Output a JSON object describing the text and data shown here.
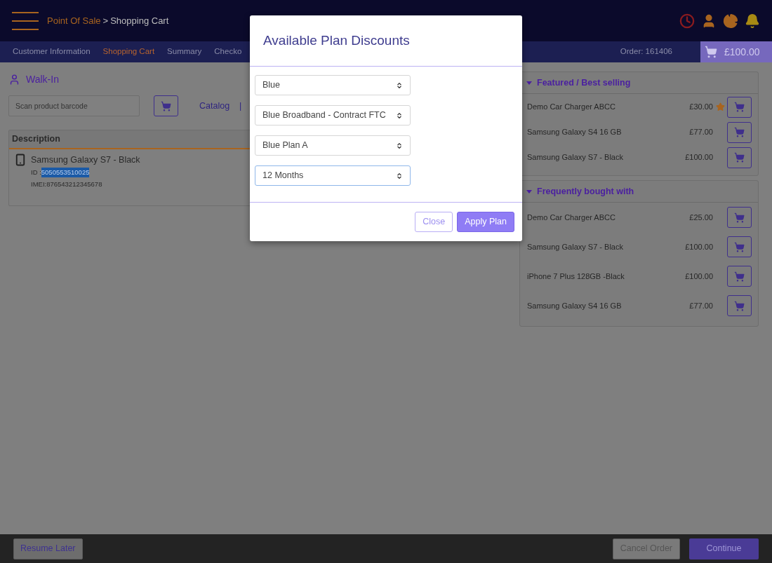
{
  "header": {
    "breadcrumb_root": "Point Of Sale",
    "breadcrumb_separator": ">",
    "breadcrumb_current": "Shopping Cart"
  },
  "nav": {
    "tabs": [
      {
        "label": "Customer Information",
        "selected": false
      },
      {
        "label": "Shopping Cart",
        "selected": true
      },
      {
        "label": "Summary",
        "selected": false
      },
      {
        "label": "Checko",
        "selected": false
      }
    ],
    "order": "Order: 161406",
    "cart_total": "£100.00"
  },
  "customer": "Walk-In",
  "scan": {
    "placeholder": "Scan product barcode"
  },
  "links": [
    "Catalog",
    "|"
  ],
  "cart_table": {
    "columns": [
      "Description"
    ],
    "rows": [
      {
        "name": "Samsung Galaxy S7 - Black",
        "id_label": "ID :",
        "id": "5050553510025",
        "id_selected": true,
        "imei": "IMEI:876543212345678"
      }
    ]
  },
  "panels": [
    {
      "title": "Featured / Best selling",
      "expanded": true,
      "items": [
        {
          "name": "Demo Car Charger ABCC",
          "price": "£30.00",
          "starred": true
        },
        {
          "name": "Samsung Galaxy S4 16 GB",
          "price": "£77.00",
          "starred": false
        },
        {
          "name": "Samsung Galaxy S7 - Black",
          "price": "£100.00",
          "starred": false
        }
      ]
    },
    {
      "title": "Frequently bought with",
      "expanded": true,
      "items": [
        {
          "name": "Demo Car Charger ABCC",
          "price": "£25.00",
          "starred": false
        },
        {
          "name": "Samsung Galaxy S7 - Black",
          "price": "£100.00",
          "starred": false
        },
        {
          "name": "iPhone 7 Plus 128GB -Black",
          "price": "£100.00",
          "starred": false
        },
        {
          "name": "Samsung Galaxy S4 16 GB",
          "price": "£77.00",
          "starred": false
        }
      ]
    }
  ],
  "footer": {
    "resume": "Resume Later",
    "cancel": "Cancel Order",
    "continue": "Continue"
  },
  "modal": {
    "title": "Available Plan Discounts",
    "selects": [
      {
        "value": "Blue",
        "focused": false
      },
      {
        "value": "Blue Broadband - Contract FTC",
        "focused": false
      },
      {
        "value": "Blue Plan A",
        "focused": false
      },
      {
        "value": "12 Months",
        "focused": true
      }
    ],
    "buttons": [
      {
        "label": "Close",
        "kind": "secondary"
      },
      {
        "label": "Apply Plan",
        "kind": "primary"
      }
    ]
  }
}
